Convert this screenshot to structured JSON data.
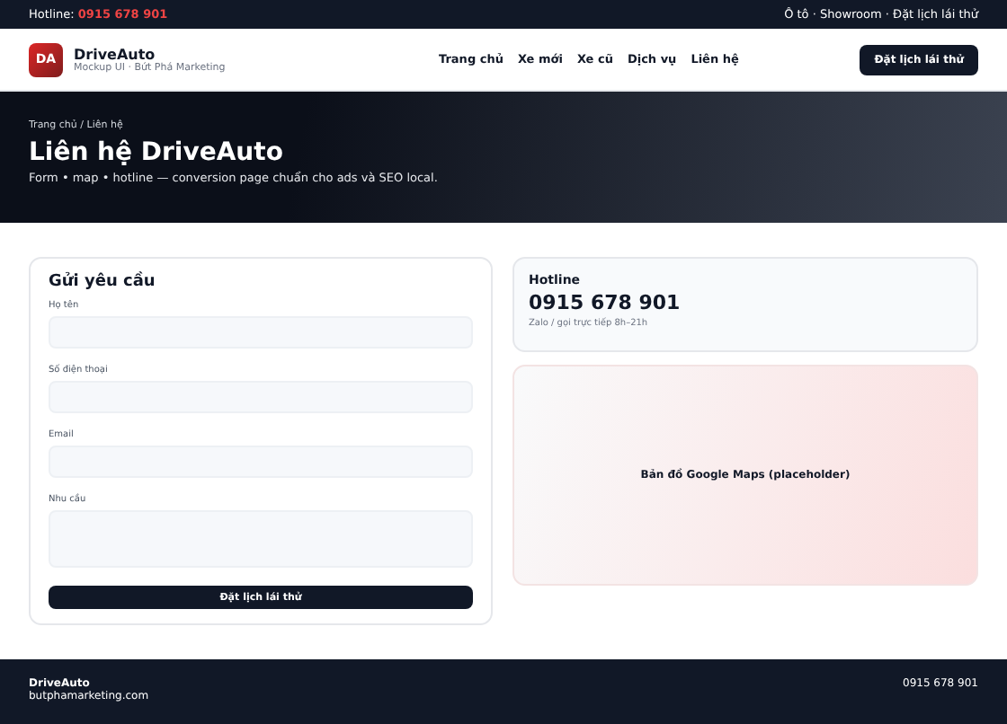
{
  "topbar": {
    "hotline_label": "Hotline:",
    "hotline_number": "0915 678 901",
    "links": "Ô tô · Showroom · Đặt lịch lái thử"
  },
  "header": {
    "logo": "DA",
    "brand": "DriveAuto",
    "tagline": "Mockup UI · Bứt Phá Marketing",
    "nav": [
      "Trang chủ",
      "Xe mới",
      "Xe cũ",
      "Dịch vụ",
      "Liên hệ"
    ],
    "cta": "Đặt lịch lái thử"
  },
  "hero": {
    "breadcrumb": "Trang chủ / Liên hệ",
    "title": "Liên hệ DriveAuto",
    "subtitle": "Form • map • hotline — conversion page chuẩn cho ads và SEO local."
  },
  "form": {
    "title": "Gửi yêu cầu",
    "fields": [
      {
        "label": "Họ tên",
        "kind": "input"
      },
      {
        "label": "Số điện thoại",
        "kind": "input"
      },
      {
        "label": "Email",
        "kind": "input"
      },
      {
        "label": "Nhu cầu",
        "kind": "textarea"
      }
    ],
    "submit": "Đặt lịch lái thử"
  },
  "hotline": {
    "title": "Hotline",
    "number": "0915 678 901",
    "note": "Zalo / gọi trực tiếp 8h–21h"
  },
  "map": {
    "text": "Bản đồ Google Maps (placeholder)"
  },
  "footer": {
    "brand": "DriveAuto",
    "site": "butphamarketing.com",
    "phone": "0915 678 901"
  }
}
